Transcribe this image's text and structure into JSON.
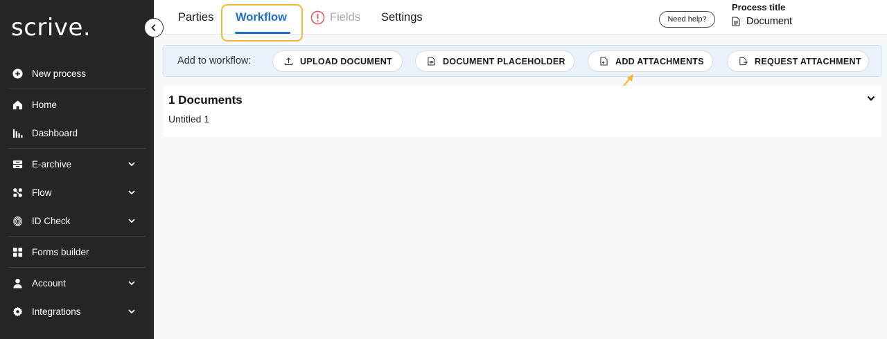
{
  "sidebar": {
    "logo": "scrive.",
    "items": [
      {
        "label": "New process",
        "icon": "plus-circle-icon"
      },
      {
        "label": "Home",
        "icon": "home-icon"
      },
      {
        "label": "Dashboard",
        "icon": "bar-chart-icon"
      },
      {
        "label": "E-archive",
        "icon": "archive-icon"
      },
      {
        "label": "Flow",
        "icon": "flow-icon"
      },
      {
        "label": "ID Check",
        "icon": "fingerprint-icon"
      },
      {
        "label": "Forms builder",
        "icon": "grid-icon"
      },
      {
        "label": "Account",
        "icon": "person-icon"
      },
      {
        "label": "Integrations",
        "icon": "gear-icon"
      }
    ]
  },
  "header": {
    "tabs": [
      {
        "label": "Parties",
        "state": "default"
      },
      {
        "label": "Workflow",
        "state": "active"
      },
      {
        "label": "Fields",
        "state": "disabled-warning"
      },
      {
        "label": "Settings",
        "state": "default"
      }
    ],
    "help_label": "Need help?",
    "process_title_label": "Process title",
    "process_document_label": "Document"
  },
  "workflow_bar": {
    "label": "Add to workflow:",
    "buttons": [
      {
        "label": "UPLOAD DOCUMENT",
        "icon": "upload-icon"
      },
      {
        "label": "DOCUMENT PLACEHOLDER",
        "icon": "document-icon"
      },
      {
        "label": "ADD ATTACHMENTS",
        "icon": "attachment-icon"
      },
      {
        "label": "REQUEST ATTACHMENT",
        "icon": "request-attachment-icon"
      }
    ]
  },
  "documents": {
    "title": "1 Documents",
    "items": [
      "Untitled 1"
    ]
  },
  "colors": {
    "sidebar_bg": "#252628",
    "accent": "#1f6fc5",
    "highlight": "#f5b731",
    "warning": "#e0595a"
  }
}
